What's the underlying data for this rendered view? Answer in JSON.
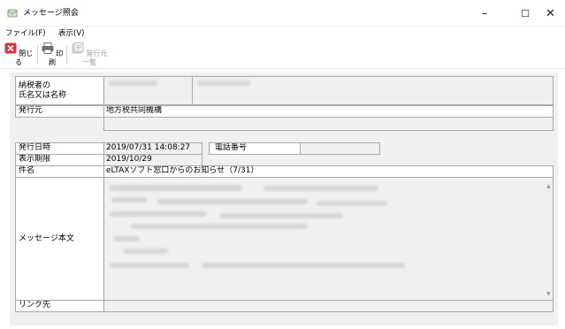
{
  "window": {
    "title": "メッセージ照会",
    "minimize_glyph": "–",
    "maximize_glyph": "☐",
    "close_glyph": "✕"
  },
  "menu": {
    "items": [
      "ファイル(F)",
      "表示(V)"
    ]
  },
  "toolbar": {
    "close_label": "閉じる",
    "print_label": "印刷",
    "issuer_list_label": "発行元一覧",
    "icons": {
      "close": "close-red-x-icon",
      "print": "printer-icon",
      "issuer_list": "issuer-list-icon"
    }
  },
  "form": {
    "taxpayer_label": "納税者の\n氏名又は名称",
    "issuer_label": "発行元",
    "issuer_value": "地方税共同機構",
    "issue_datetime_label": "発行日時",
    "issue_datetime_value": "2019/07/31 14:08:27",
    "phone_label": "電話番号",
    "phone_value": "",
    "display_deadline_label": "表示期限",
    "display_deadline_value": "2019/10/29",
    "subject_label": "件名",
    "subject_value": "eLTAXソフト窓口からのお知らせ（7/31）",
    "body_label": "メッセージ本文",
    "link_label": "リンク先",
    "link_value": ""
  },
  "colors": {
    "close_icon_red": "#e0303a",
    "border": "#a9a9a9",
    "panel_bg": "#f0f0f0"
  }
}
